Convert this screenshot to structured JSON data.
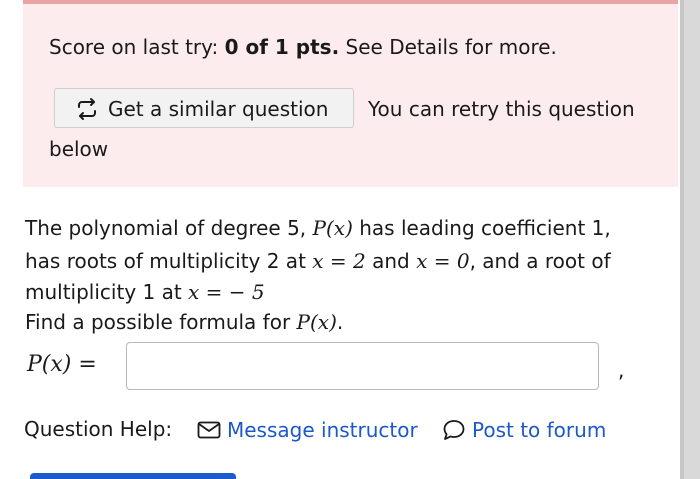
{
  "score": {
    "prefix": "Score on last try: ",
    "value": "0 of 1 pts.",
    "suffix": " See Details for more."
  },
  "retry": {
    "button_label": "Get a similar question",
    "button_icon": "retry-arrows-icon",
    "text_line1": "You can retry this question",
    "text_line2": "below"
  },
  "question": {
    "line1_text": "The polynomial of degree 5, ",
    "line1_math": "P(x)",
    "line1_rest": " has leading coefficient 1,",
    "line2_a": "has roots of multiplicity 2 at ",
    "line2_math1": "x = 2",
    "line2_b": " and ",
    "line2_math2": "x = 0",
    "line2_c": ", and a root of",
    "line3_a": "multiplicity 1 at ",
    "line3_math": "x = − 5",
    "line4_a": "Find a possible formula for ",
    "line4_math": "P(x)",
    "line4_b": "."
  },
  "answer": {
    "label": "P(x) =",
    "value": "",
    "trailing": ","
  },
  "help": {
    "label": "Question Help:",
    "message_link": "Message instructor",
    "message_icon": "envelope-icon",
    "forum_link": "Post to forum",
    "forum_icon": "speech-bubble-icon"
  },
  "colors": {
    "score_panel_bg": "#fdeced",
    "link": "#1d58c8",
    "button_bg": "#f2f2f2"
  }
}
